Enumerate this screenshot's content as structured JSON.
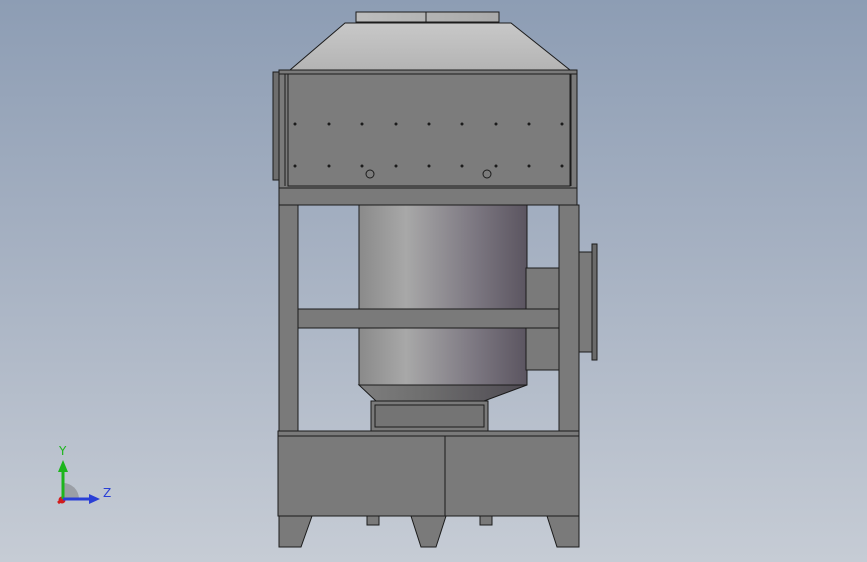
{
  "viewport": {
    "background_top": "#8d9db4",
    "background_bottom": "#c6ccd5"
  },
  "model": {
    "body_color": "#7e7e7e",
    "edge_color": "#1b1b1b",
    "cylinder_light": "#a6a6a6",
    "cylinder_dark": "#5e5a62"
  },
  "triad": {
    "y_label": "Y",
    "z_label": "Z",
    "y_color": "#1db51d",
    "z_color": "#2a3fd6",
    "x_color": "#d21c1c"
  }
}
